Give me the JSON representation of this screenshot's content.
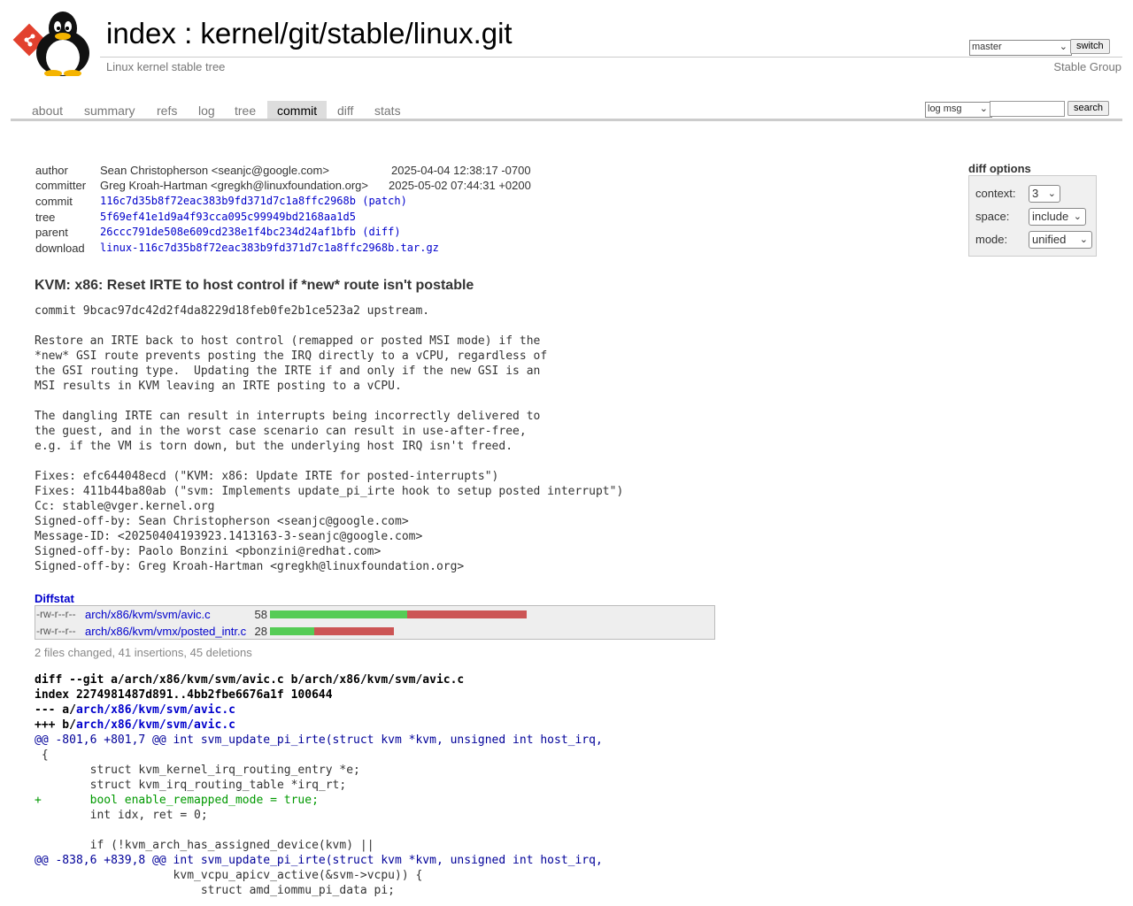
{
  "header": {
    "index_label": "index",
    "separator": ":",
    "repo_path": "kernel/git/stable/linux.git",
    "description": "Linux kernel stable tree",
    "owner": "Stable Group",
    "branch_selected": "master",
    "switch_label": "switch"
  },
  "tabs": [
    "about",
    "summary",
    "refs",
    "log",
    "tree",
    "commit",
    "diff",
    "stats"
  ],
  "active_tab": "commit",
  "search": {
    "mode_selected": "log msg",
    "query": "",
    "button_label": "search"
  },
  "commit_info": {
    "author_label": "author",
    "author": "Sean Christopherson <seanjc@google.com>",
    "author_date": "2025-04-04 12:38:17 -0700",
    "committer_label": "committer",
    "committer": "Greg Kroah-Hartman <gregkh@linuxfoundation.org>",
    "committer_date": "2025-05-02 07:44:31 +0200",
    "commit_label": "commit",
    "commit_hash": "116c7d35b8f72eac383b9fd371d7c1a8ffc2968b",
    "patch_link": "(patch)",
    "tree_label": "tree",
    "tree_hash": "5f69ef41e1d9a4f93cca095c99949bd2168aa1d5",
    "parent_label": "parent",
    "parent_hash": "26ccc791de508e609cd238e1f4bc234d24af1bfb",
    "diff_link": "(diff)",
    "download_label": "download",
    "download_file": "linux-116c7d35b8f72eac383b9fd371d7c1a8ffc2968b.tar.gz"
  },
  "diff_options": {
    "title": "diff options",
    "context_label": "context:",
    "context_value": "3",
    "space_label": "space:",
    "space_value": "include",
    "mode_label": "mode:",
    "mode_value": "unified"
  },
  "subject": "KVM: x86: Reset IRTE to host control if *new* route isn't postable",
  "message": "commit 9bcac97dc42d2f4da8229d18feb0fe2b1ce523a2 upstream.\n\nRestore an IRTE back to host control (remapped or posted MSI mode) if the\n*new* GSI route prevents posting the IRQ directly to a vCPU, regardless of\nthe GSI routing type.  Updating the IRTE if and only if the new GSI is an\nMSI results in KVM leaving an IRTE posting to a vCPU.\n\nThe dangling IRTE can result in interrupts being incorrectly delivered to\nthe guest, and in the worst case scenario can result in use-after-free,\ne.g. if the VM is torn down, but the underlying host IRQ isn't freed.\n\nFixes: efc644048ecd (\"KVM: x86: Update IRTE for posted-interrupts\")\nFixes: 411b44ba80ab (\"svm: Implements update_pi_irte hook to setup posted interrupt\")\nCc: stable@vger.kernel.org\nSigned-off-by: Sean Christopherson <seanjc@google.com>\nMessage-ID: <20250404193923.1413163-3-seanjc@google.com>\nSigned-off-by: Paolo Bonzini <pbonzini@redhat.com>\nSigned-off-by: Greg Kroah-Hartman <gregkh@linuxfoundation.org>",
  "diffstat": {
    "title": "Diffstat",
    "files": [
      {
        "mode": "-rw-r--r--",
        "path": "arch/x86/kvm/svm/avic.c",
        "changes": "58",
        "insertions": 31,
        "deletions": 27
      },
      {
        "mode": "-rw-r--r--",
        "path": "arch/x86/kvm/vmx/posted_intr.c",
        "changes": "28",
        "insertions": 10,
        "deletions": 18
      }
    ],
    "summary": "2 files changed, 41 insertions, 45 deletions"
  },
  "diff": {
    "line1": "diff --git a/arch/x86/kvm/svm/avic.c b/arch/x86/kvm/svm/avic.c",
    "line2": "index 2274981487d891..4bb2fbe6676a1f 100644",
    "minus_prefix": "--- a/",
    "minus_path": "arch/x86/kvm/svm/avic.c",
    "plus_prefix": "+++ b/",
    "plus_path": "arch/x86/kvm/svm/avic.c",
    "hunk1": "@@ -801,6 +801,7 @@ int svm_update_pi_irte(struct kvm *kvm, unsigned int host_irq,",
    "c1": " {",
    "c2": " \tstruct kvm_kernel_irq_routing_entry *e;",
    "c3": " \tstruct kvm_irq_routing_table *irq_rt;",
    "a1": "+\tbool enable_remapped_mode = true;",
    "c4": " \tint idx, ret = 0;",
    "c5": " ",
    "c6": " \tif (!kvm_arch_has_assigned_device(kvm) ||",
    "hunk2": "@@ -838,6 +839,8 @@ int svm_update_pi_irte(struct kvm *kvm, unsigned int host_irq,",
    "c7": " \t\t    kvm_vcpu_apicv_active(&svm->vcpu)) {",
    "c8": " \t\t\tstruct amd_iommu_pi_data pi;"
  },
  "colors": {
    "link": "#0000cc",
    "insertion_bar": "#55cc55",
    "deletion_bar": "#cc5555",
    "hunk": "#000099",
    "added_line": "#009900",
    "active_tab_bg": "#dddddd"
  },
  "icons": [
    "git-logo-icon",
    "tux-penguin-icon",
    "chevron-down-icon"
  ]
}
